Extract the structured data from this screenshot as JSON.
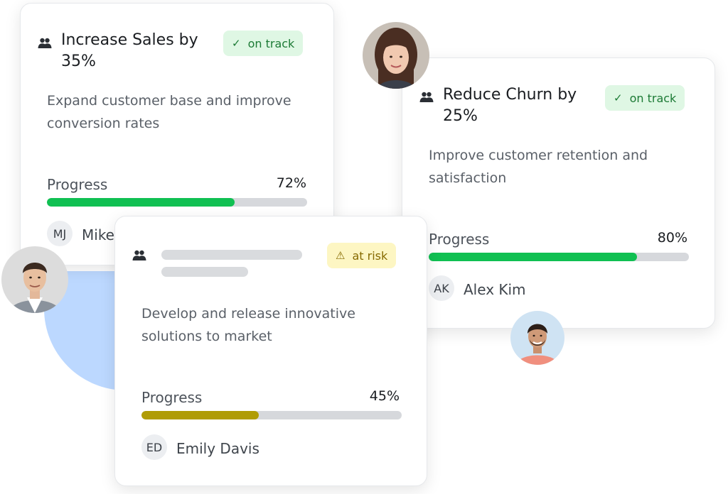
{
  "colors": {
    "accent_green": "#10c052",
    "accent_olive": "#b09c05",
    "track_gray": "#d6d8dc",
    "badge_ok_bg": "#dff7e4",
    "badge_warn_bg": "#fdf6c3",
    "blob_blue": "#bcd8ff"
  },
  "cards": [
    {
      "icon": "users-icon",
      "title": "Increase Sales by 35%",
      "status": {
        "label": "on track",
        "icon": "check-icon"
      },
      "description": "Expand customer base and improve conversion rates",
      "progress_label": "Progress",
      "progress_value": "72%",
      "progress": 0.72,
      "owner": {
        "initials": "MJ",
        "name": "Mike"
      }
    },
    {
      "icon": "users-icon",
      "title": "Reduce Churn by 25%",
      "status": {
        "label": "on track",
        "icon": "check-icon"
      },
      "description": "Improve customer retention and satisfaction",
      "progress_label": "Progress",
      "progress_value": "80%",
      "progress": 0.8,
      "owner": {
        "initials": "AK",
        "name": "Alex Kim"
      }
    },
    {
      "icon": "users-icon",
      "title": "",
      "status": {
        "label": "at risk",
        "icon": "warning-icon"
      },
      "description": "Develop and release innovative solutions to market",
      "progress_label": "Progress",
      "progress_value": "45%",
      "progress": 0.45,
      "owner": {
        "initials": "ED",
        "name": "Emily Davis"
      }
    }
  ]
}
